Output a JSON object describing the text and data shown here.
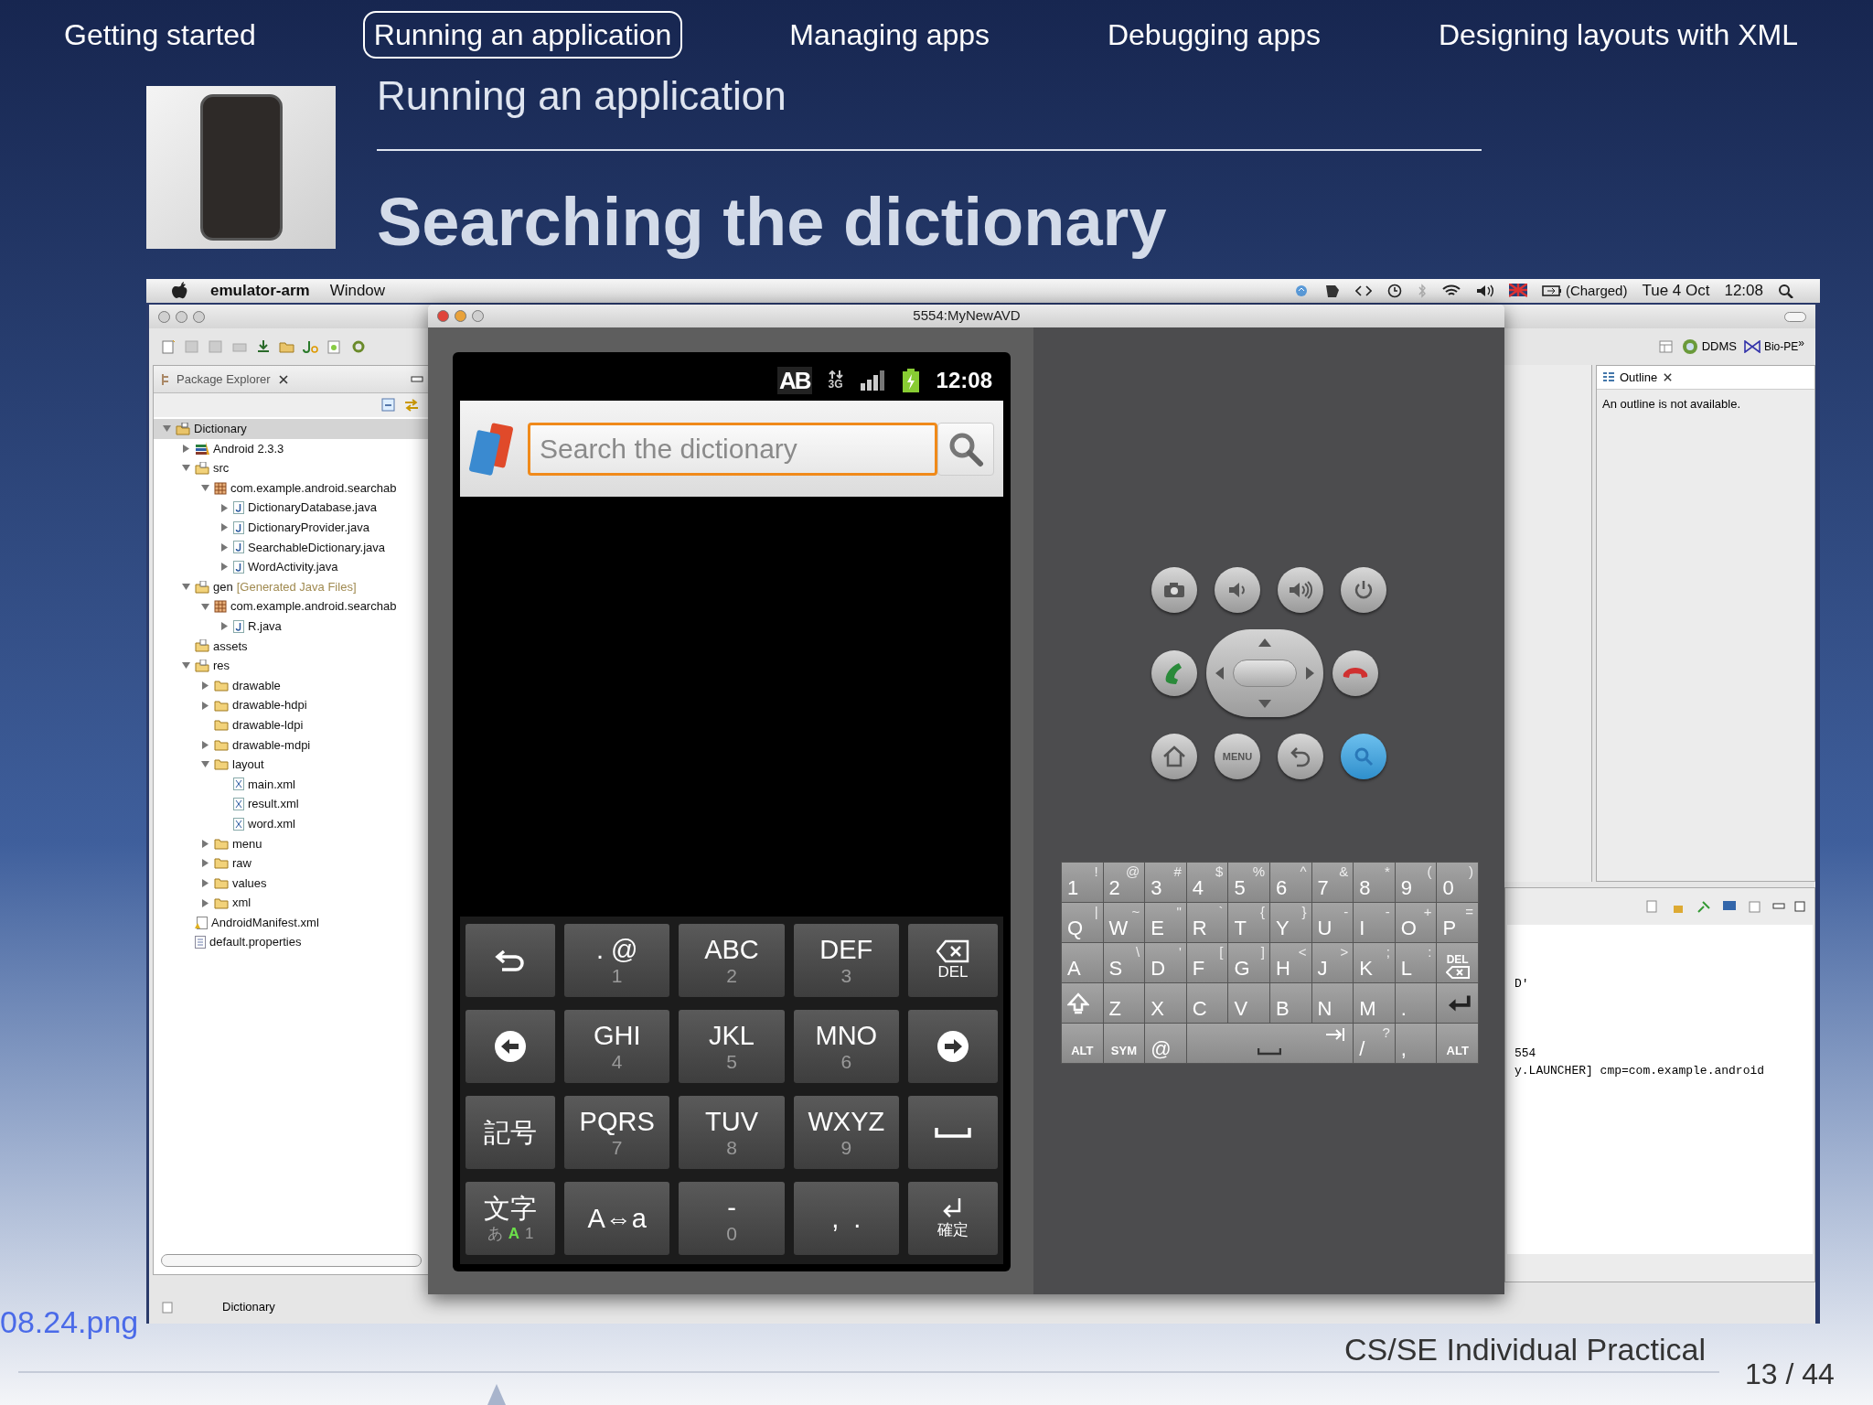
{
  "nav": [
    {
      "label": "Getting started",
      "selected": false
    },
    {
      "label": "Running an application",
      "selected": true
    },
    {
      "label": "Managing apps",
      "selected": false
    },
    {
      "label": "Debugging apps",
      "selected": false
    },
    {
      "label": "Designing layouts with XML",
      "selected": false
    }
  ],
  "header": {
    "section": "Running an application",
    "title": "Searching the dictionary"
  },
  "menubar": {
    "app": "emulator-arm",
    "menus": [
      "Window"
    ],
    "battery": "(Charged)",
    "date": "Tue 4 Oct",
    "time": "12:08"
  },
  "eclipse": {
    "perspectives": [
      "DDMS",
      "Bio-PE"
    ],
    "overflow": "»",
    "package_explorer": {
      "title": "Package Explorer",
      "tree": [
        {
          "label": "Dictionary",
          "kind": "project",
          "expanded": true,
          "selected": true,
          "children": [
            {
              "label": "Android 2.3.3",
              "kind": "library",
              "expanded": false,
              "selected": false
            },
            {
              "label": "src",
              "kind": "source",
              "expanded": true,
              "selected": false,
              "children": [
                {
                  "label": "com.example.android.searchab",
                  "kind": "package",
                  "expanded": true,
                  "selected": false,
                  "children": [
                    {
                      "label": "DictionaryDatabase.java",
                      "kind": "java",
                      "expanded": false,
                      "selected": false
                    },
                    {
                      "label": "DictionaryProvider.java",
                      "kind": "java",
                      "expanded": false,
                      "selected": false
                    },
                    {
                      "label": "SearchableDictionary.java",
                      "kind": "java",
                      "expanded": false,
                      "selected": false
                    },
                    {
                      "label": "WordActivity.java",
                      "kind": "java",
                      "expanded": false,
                      "selected": false
                    }
                  ]
                }
              ]
            },
            {
              "label": "gen",
              "note": "[Generated Java Files]",
              "kind": "source",
              "expanded": true,
              "selected": false,
              "children": [
                {
                  "label": "com.example.android.searchab",
                  "kind": "package",
                  "expanded": true,
                  "selected": false,
                  "children": [
                    {
                      "label": "R.java",
                      "kind": "java",
                      "expanded": false,
                      "selected": false
                    }
                  ]
                }
              ]
            },
            {
              "label": "assets",
              "kind": "source",
              "selected": false
            },
            {
              "label": "res",
              "kind": "source",
              "expanded": true,
              "selected": false,
              "children": [
                {
                  "label": "drawable",
                  "kind": "folder",
                  "expanded": false,
                  "selected": false
                },
                {
                  "label": "drawable-hdpi",
                  "kind": "folder",
                  "expanded": false,
                  "selected": false
                },
                {
                  "label": "drawable-ldpi",
                  "kind": "folder",
                  "selected": false
                },
                {
                  "label": "drawable-mdpi",
                  "kind": "folder",
                  "expanded": false,
                  "selected": false
                },
                {
                  "label": "layout",
                  "kind": "folder",
                  "expanded": true,
                  "selected": false,
                  "children": [
                    {
                      "label": "main.xml",
                      "kind": "xml",
                      "selected": false
                    },
                    {
                      "label": "result.xml",
                      "kind": "xml",
                      "selected": false
                    },
                    {
                      "label": "word.xml",
                      "kind": "xml",
                      "selected": false
                    }
                  ]
                },
                {
                  "label": "menu",
                  "kind": "folder",
                  "expanded": false,
                  "selected": false
                },
                {
                  "label": "raw",
                  "kind": "folder",
                  "expanded": false,
                  "selected": false
                },
                {
                  "label": "values",
                  "kind": "folder",
                  "expanded": false,
                  "selected": false
                },
                {
                  "label": "xml",
                  "kind": "folder",
                  "expanded": false,
                  "selected": false
                }
              ]
            },
            {
              "label": "AndroidManifest.xml",
              "kind": "manifest",
              "selected": false
            },
            {
              "label": "default.properties",
              "kind": "file",
              "selected": false
            }
          ]
        }
      ]
    },
    "outline": {
      "title": "Outline",
      "message": "An outline is not available."
    },
    "console": {
      "blocks": [
        [
          "D'"
        ],
        [
          "554",
          "y.LAUNCHER] cmp=com.example.android"
        ]
      ]
    },
    "status_bar": {
      "text": "Dictionary"
    }
  },
  "emulator": {
    "title": "5554:MyNewAVD",
    "status": {
      "ime": "AB",
      "network": "3G",
      "time": "12:08"
    },
    "search": {
      "placeholder": "Search the dictionary"
    },
    "keypad": [
      {
        "kind": "back"
      },
      {
        "kind": "text",
        "label": ". @",
        "sub": "1"
      },
      {
        "kind": "text",
        "label": "ABC",
        "sub": "2"
      },
      {
        "kind": "text",
        "label": "DEF",
        "sub": "3"
      },
      {
        "kind": "delete",
        "label": "DEL"
      },
      {
        "kind": "left"
      },
      {
        "kind": "text",
        "label": "GHI",
        "sub": "4"
      },
      {
        "kind": "text",
        "label": "JKL",
        "sub": "5"
      },
      {
        "kind": "text",
        "label": "MNO",
        "sub": "6"
      },
      {
        "kind": "right"
      },
      {
        "kind": "text",
        "label": "記号"
      },
      {
        "kind": "text",
        "label": "PQRS",
        "sub": "7"
      },
      {
        "kind": "text",
        "label": "TUV",
        "sub": "8"
      },
      {
        "kind": "text",
        "label": "WXYZ",
        "sub": "9"
      },
      {
        "kind": "space"
      },
      {
        "kind": "mode",
        "label": "文字",
        "sub_parts": [
          {
            "text": "あ",
            "highlighted": false
          },
          {
            "text": "A",
            "highlighted": true
          },
          {
            "text": "1",
            "highlighted": false
          }
        ]
      },
      {
        "kind": "text",
        "label": "A⇔a"
      },
      {
        "kind": "text",
        "label": "-",
        "sub": "0"
      },
      {
        "kind": "text",
        "label": ",  ."
      },
      {
        "kind": "enter",
        "label": "確定"
      }
    ],
    "hardware": {
      "menu_label": "MENU"
    },
    "qwerty": [
      [
        {
          "kind": "char",
          "label": "1",
          "alt": "!"
        },
        {
          "kind": "char",
          "label": "2",
          "alt": "@"
        },
        {
          "kind": "char",
          "label": "3",
          "alt": "#"
        },
        {
          "kind": "char",
          "label": "4",
          "alt": "$"
        },
        {
          "kind": "char",
          "label": "5",
          "alt": "%"
        },
        {
          "kind": "char",
          "label": "6",
          "alt": "^"
        },
        {
          "kind": "char",
          "label": "7",
          "alt": "&"
        },
        {
          "kind": "char",
          "label": "8",
          "alt": "*"
        },
        {
          "kind": "char",
          "label": "9",
          "alt": "("
        },
        {
          "kind": "char",
          "label": "0",
          "alt": ")"
        }
      ],
      [
        {
          "kind": "char",
          "label": "Q",
          "alt": "|"
        },
        {
          "kind": "char",
          "label": "W",
          "alt": "~"
        },
        {
          "kind": "char",
          "label": "E",
          "alt": "\""
        },
        {
          "kind": "char",
          "label": "R",
          "alt": "`"
        },
        {
          "kind": "char",
          "label": "T",
          "alt": "{"
        },
        {
          "kind": "char",
          "label": "Y",
          "alt": "}"
        },
        {
          "kind": "char",
          "label": "U",
          "alt": "-"
        },
        {
          "kind": "char",
          "label": "I",
          "alt": "-"
        },
        {
          "kind": "char",
          "label": "O",
          "alt": "+"
        },
        {
          "kind": "char",
          "label": "P",
          "alt": "="
        }
      ],
      [
        {
          "kind": "char",
          "label": "A"
        },
        {
          "kind": "char",
          "label": "S",
          "alt": "\\"
        },
        {
          "kind": "char",
          "label": "D",
          "alt": "'"
        },
        {
          "kind": "char",
          "label": "F",
          "alt": "["
        },
        {
          "kind": "char",
          "label": "G",
          "alt": "]"
        },
        {
          "kind": "char",
          "label": "H",
          "alt": "<"
        },
        {
          "kind": "char",
          "label": "J",
          "alt": ">"
        },
        {
          "kind": "char",
          "label": "K",
          "alt": ";"
        },
        {
          "kind": "char",
          "label": "L",
          "alt": ":"
        },
        {
          "kind": "delete",
          "label": "DEL"
        }
      ],
      [
        {
          "kind": "shift"
        },
        {
          "kind": "char",
          "label": "Z"
        },
        {
          "kind": "char",
          "label": "X"
        },
        {
          "kind": "char",
          "label": "C"
        },
        {
          "kind": "char",
          "label": "V"
        },
        {
          "kind": "char",
          "label": "B"
        },
        {
          "kind": "char",
          "label": "N"
        },
        {
          "kind": "char",
          "label": "M"
        },
        {
          "kind": "char",
          "label": "."
        },
        {
          "kind": "enter"
        }
      ],
      [
        {
          "kind": "mod",
          "label": "ALT"
        },
        {
          "kind": "mod",
          "label": "SYM"
        },
        {
          "kind": "char",
          "label": "@"
        },
        {
          "kind": "space"
        },
        {
          "kind": "char",
          "label": "/",
          "alt": "?"
        },
        {
          "kind": "char",
          "label": ","
        },
        {
          "kind": "mod",
          "label": "ALT"
        }
      ]
    ]
  },
  "footer": {
    "file_label": "08.24.png",
    "course": "CS/SE Individual Practical",
    "page": "13 / 44"
  }
}
